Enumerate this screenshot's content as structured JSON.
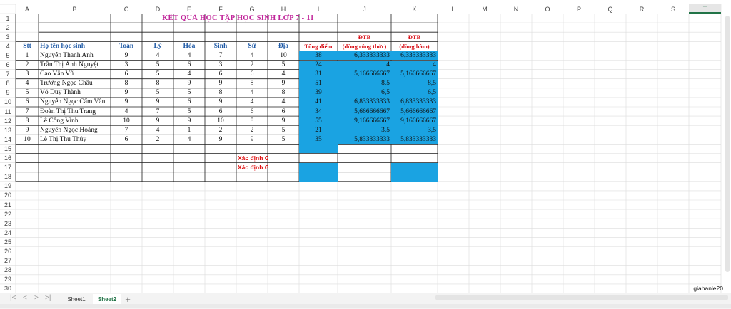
{
  "columns": [
    "A",
    "B",
    "C",
    "D",
    "E",
    "F",
    "G",
    "H",
    "I",
    "J",
    "K",
    "L",
    "M",
    "N",
    "O",
    "P",
    "Q",
    "R",
    "S",
    "T"
  ],
  "selected_column": "T",
  "rows": [
    "1",
    "2",
    "3",
    "4",
    "5",
    "6",
    "7",
    "8",
    "9",
    "10",
    "11",
    "12",
    "13",
    "14",
    "15",
    "16",
    "17",
    "18",
    "19",
    "20",
    "21",
    "22",
    "23",
    "24",
    "25",
    "26",
    "27",
    "28",
    "29",
    "30"
  ],
  "title": "KẾT QUẢ HỌC TẬP HỌC SINH LỚP 7 - 11",
  "headers": {
    "stt": "Stt",
    "name": "Họ tên học sinh",
    "toan": "Toán",
    "ly": "Lý",
    "hoa": "Hóa",
    "sinh": "Sinh",
    "su": "Sử",
    "dia": "Địa",
    "tong": "Tổng điểm",
    "dtb1_top": "ĐTB",
    "dtb1": "(dùng công thức)",
    "dtb2_top": "ĐTB",
    "dtb2": "(dùng hàm)"
  },
  "students": [
    {
      "stt": "1",
      "name": "Nguyễn Thanh Anh",
      "toan": "9",
      "ly": "4",
      "hoa": "4",
      "sinh": "7",
      "su": "4",
      "dia": "10",
      "tong": "38",
      "dtb1": "6,333333333",
      "dtb2": "6,333333333"
    },
    {
      "stt": "2",
      "name": "Trần Thị Ánh Nguyệt",
      "toan": "3",
      "ly": "5",
      "hoa": "6",
      "sinh": "3",
      "su": "2",
      "dia": "5",
      "tong": "24",
      "dtb1": "4",
      "dtb2": "4"
    },
    {
      "stt": "3",
      "name": "Cao Văn Vũ",
      "toan": "6",
      "ly": "5",
      "hoa": "4",
      "sinh": "6",
      "su": "6",
      "dia": "4",
      "tong": "31",
      "dtb1": "5,166666667",
      "dtb2": "5,166666667"
    },
    {
      "stt": "4",
      "name": "Trương Ngọc Châu",
      "toan": "8",
      "ly": "8",
      "hoa": "9",
      "sinh": "9",
      "su": "8",
      "dia": "9",
      "tong": "51",
      "dtb1": "8,5",
      "dtb2": "8,5"
    },
    {
      "stt": "5",
      "name": "Võ Duy Thành",
      "toan": "9",
      "ly": "5",
      "hoa": "5",
      "sinh": "8",
      "su": "4",
      "dia": "8",
      "tong": "39",
      "dtb1": "6,5",
      "dtb2": "6,5"
    },
    {
      "stt": "6",
      "name": "Nguyễn Ngọc Cẩm Vân",
      "toan": "9",
      "ly": "9",
      "hoa": "6",
      "sinh": "9",
      "su": "4",
      "dia": "4",
      "tong": "41",
      "dtb1": "6,833333333",
      "dtb2": "6,833333333"
    },
    {
      "stt": "7",
      "name": "Đoàn Thị Thu Trang",
      "toan": "4",
      "ly": "7",
      "hoa": "5",
      "sinh": "6",
      "su": "6",
      "dia": "6",
      "tong": "34",
      "dtb1": "5,666666667",
      "dtb2": "5,666666667"
    },
    {
      "stt": "8",
      "name": "Lê Công Vinh",
      "toan": "10",
      "ly": "9",
      "hoa": "9",
      "sinh": "10",
      "su": "8",
      "dia": "9",
      "tong": "55",
      "dtb1": "9,166666667",
      "dtb2": "9,166666667"
    },
    {
      "stt": "9",
      "name": "Nguyễn Ngọc Hoàng",
      "toan": "7",
      "ly": "4",
      "hoa": "1",
      "sinh": "2",
      "su": "2",
      "dia": "5",
      "tong": "21",
      "dtb1": "3,5",
      "dtb2": "3,5"
    },
    {
      "stt": "10",
      "name": "Lê Thị Thu Thủy",
      "toan": "6",
      "ly": "2",
      "hoa": "4",
      "sinh": "9",
      "su": "9",
      "dia": "5",
      "tong": "35",
      "dtb1": "5,833333333",
      "dtb2": "5,833333333"
    }
  ],
  "labels": {
    "gtln": "Xác định GTLN",
    "gtnn": "Xác định GTNN"
  },
  "corner_text": "giahanle20",
  "sheets": [
    {
      "name": "Sheet1",
      "active": false
    },
    {
      "name": "Sheet2",
      "active": true
    }
  ],
  "add_sheet": "+",
  "colors": {
    "accent_fill": "#1aa3e2",
    "title": "#c1279b",
    "header_blue": "#1f5aa6",
    "header_red": "#d8141c",
    "active_tab": "#217346"
  }
}
